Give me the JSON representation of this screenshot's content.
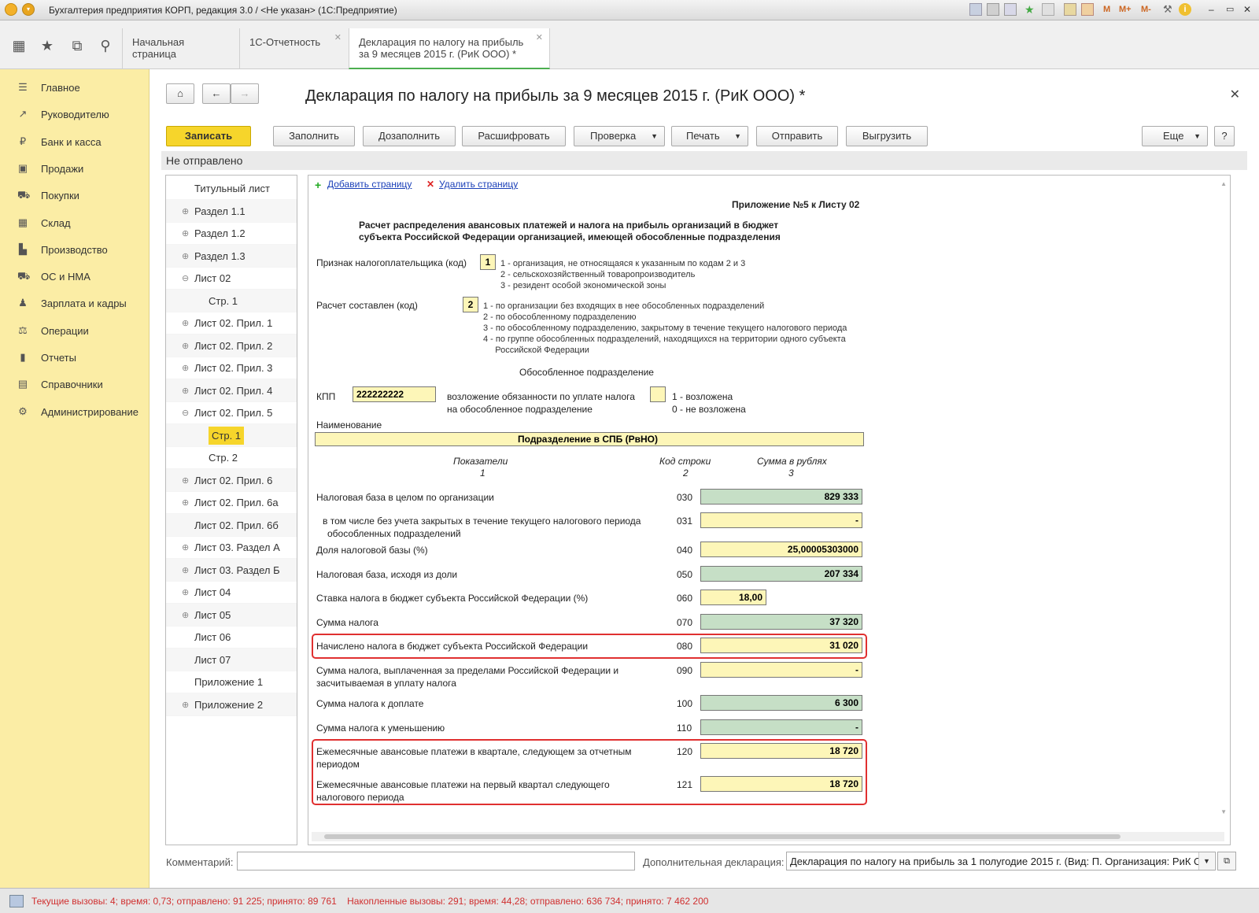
{
  "app": {
    "title": "Бухгалтерия предприятия КОРП, редакция 3.0 / <Не указан>  (1С:Предприятие)"
  },
  "titlebar_tools": {
    "m": "M",
    "mplus": "M+",
    "mminus": "M-"
  },
  "tabs": [
    {
      "label": "Начальная страница"
    },
    {
      "label": "1С-Отчетность"
    },
    {
      "label": "Декларация по налогу на прибыль\nза 9 месяцев 2015 г. (РиК ООО) *"
    }
  ],
  "sidebar": {
    "items": [
      {
        "label": "Главное",
        "icon": "menu-icon"
      },
      {
        "label": "Руководителю",
        "icon": "trend-icon"
      },
      {
        "label": "Банк и касса",
        "icon": "ruble-icon"
      },
      {
        "label": "Продажи",
        "icon": "bag-icon"
      },
      {
        "label": "Покупки",
        "icon": "cart-icon"
      },
      {
        "label": "Склад",
        "icon": "warehouse-icon"
      },
      {
        "label": "Производство",
        "icon": "factory-icon"
      },
      {
        "label": "ОС и НМА",
        "icon": "truck-icon"
      },
      {
        "label": "Зарплата и кадры",
        "icon": "person-icon"
      },
      {
        "label": "Операции",
        "icon": "scales-icon"
      },
      {
        "label": "Отчеты",
        "icon": "bar-chart-icon"
      },
      {
        "label": "Справочники",
        "icon": "book-icon"
      },
      {
        "label": "Администрирование",
        "icon": "gear-icon"
      }
    ]
  },
  "doc": {
    "title": "Декларация по налогу на прибыль за 9 месяцев 2015 г. (РиК ООО) *",
    "status": "Не отправлено",
    "toolbar": {
      "save": "Записать",
      "fill": "Заполнить",
      "refill": "Дозаполнить",
      "decode": "Расшифровать",
      "check": "Проверка",
      "print": "Печать",
      "send": "Отправить",
      "export": "Выгрузить",
      "more": "Еще",
      "help": "?"
    },
    "tree": [
      {
        "label": "Титульный лист",
        "expander": "",
        "level": 0
      },
      {
        "label": "Раздел 1.1",
        "expander": "⊕",
        "level": 0
      },
      {
        "label": "Раздел 1.2",
        "expander": "⊕",
        "level": 0
      },
      {
        "label": "Раздел 1.3",
        "expander": "⊕",
        "level": 0
      },
      {
        "label": "Лист 02",
        "expander": "⊖",
        "level": 0
      },
      {
        "label": "Стр. 1",
        "expander": "",
        "level": 1
      },
      {
        "label": "Лист 02. Прил. 1",
        "expander": "⊕",
        "level": 0
      },
      {
        "label": "Лист 02. Прил. 2",
        "expander": "⊕",
        "level": 0
      },
      {
        "label": "Лист 02. Прил. 3",
        "expander": "⊕",
        "level": 0
      },
      {
        "label": "Лист 02. Прил. 4",
        "expander": "⊕",
        "level": 0
      },
      {
        "label": "Лист 02. Прил. 5",
        "expander": "⊖",
        "level": 0
      },
      {
        "label": "Стр. 1",
        "expander": "",
        "level": 1,
        "selected": true
      },
      {
        "label": "Стр. 2",
        "expander": "",
        "level": 1
      },
      {
        "label": "Лист 02. Прил. 6",
        "expander": "⊕",
        "level": 0
      },
      {
        "label": "Лист 02. Прил. 6а",
        "expander": "⊕",
        "level": 0
      },
      {
        "label": "Лист 02. Прил. 6б",
        "expander": "",
        "level": 0
      },
      {
        "label": "Лист 03. Раздел А",
        "expander": "⊕",
        "level": 0
      },
      {
        "label": "Лист 03. Раздел Б",
        "expander": "⊕",
        "level": 0
      },
      {
        "label": "Лист 04",
        "expander": "⊕",
        "level": 0
      },
      {
        "label": "Лист 05",
        "expander": "⊕",
        "level": 0
      },
      {
        "label": "Лист 06",
        "expander": "",
        "level": 0
      },
      {
        "label": "Лист 07",
        "expander": "",
        "level": 0
      },
      {
        "label": "Приложение 1",
        "expander": "",
        "level": 0
      },
      {
        "label": "Приложение 2",
        "expander": "⊕",
        "level": 0
      }
    ],
    "form": {
      "add_page": "Добавить страницу",
      "del_page": "Удалить страницу",
      "appendix": "Приложение №5 к Листу 02",
      "heading1": "Расчет распределения авансовых платежей и налога на прибыль организаций в бюджет",
      "heading2": "субъекта Российской Федерации организацией, имеющей обособленные подразделения",
      "payer_label": "Признак налогоплательщика (код)",
      "payer_code": "1",
      "payer_opts": [
        "1 - организация, не относящаяся к указанным по кодам 2 и 3",
        "2 - сельскохозяйственный товаропроизводитель",
        "3 - резидент особой экономической зоны"
      ],
      "calc_label": "Расчет составлен (код)",
      "calc_code": "2",
      "calc_opts": [
        "1 - по организации без входящих в нее обособленных подразделений",
        "2 - по обособленному подразделению",
        "3 - по обособленному подразделению, закрытому в течение текущего налогового периода",
        "4 - по группе обособленных подразделений, находящихся на территории одного субъекта",
        "     Российской Федерации"
      ],
      "subdivision": "Обособленное подразделение",
      "kpp_label": "КПП",
      "kpp": "222222222",
      "duty_label1": "возложение обязанности по уплате налога",
      "duty_label2": "на обособленное подразделение",
      "duty_opt1": "1 - возложена",
      "duty_opt2": "0 - не возложена",
      "name_label": "Наименование",
      "name_value": "Подразделение в СПБ (РвНО)",
      "col1": "Показатели",
      "col1n": "1",
      "col2": "Код строки",
      "col2n": "2",
      "col3": "Сумма в рублях",
      "col3n": "3",
      "rows": [
        {
          "label": "Налоговая база в целом по организации",
          "label2": "",
          "code": "030",
          "value": "829 333",
          "color": "green",
          "narrow": false
        },
        {
          "label": "в том числе без учета закрытых в течение текущего налогового периода",
          "label2": "обособленных подразделений",
          "code": "031",
          "value": "-",
          "color": "yellow",
          "narrow": false,
          "indent": true
        },
        {
          "label": "Доля налоговой базы (%)",
          "label2": "",
          "code": "040",
          "value": "25,00005303000",
          "color": "yellow",
          "narrow": false
        },
        {
          "label": "Налоговая база, исходя из доли",
          "label2": "",
          "code": "050",
          "value": "207 334",
          "color": "green",
          "narrow": false
        },
        {
          "label": "Ставка налога в бюджет субъекта Российской Федерации (%)",
          "label2": "",
          "code": "060",
          "value": "18,00",
          "color": "yellow",
          "narrow": true
        },
        {
          "label": "Сумма налога",
          "label2": "",
          "code": "070",
          "value": "37 320",
          "color": "green",
          "narrow": false
        },
        {
          "label": "Начислено налога в бюджет субъекта Российской Федерации",
          "label2": "",
          "code": "080",
          "value": "31 020",
          "color": "yellow",
          "narrow": false
        },
        {
          "label": "Сумма налога, выплаченная за пределами Российской Федерации и",
          "label2": "засчитываемая в уплату налога",
          "code": "090",
          "value": "-",
          "color": "yellow",
          "narrow": false
        },
        {
          "label": "Сумма налога к доплате",
          "label2": "",
          "code": "100",
          "value": "6 300",
          "color": "green",
          "narrow": false
        },
        {
          "label": "Сумма налога к уменьшению",
          "label2": "",
          "code": "110",
          "value": "-",
          "color": "green",
          "narrow": false
        },
        {
          "label": "Ежемесячные авансовые платежи в квартале, следующем за отчетным",
          "label2": "периодом",
          "code": "120",
          "value": "18 720",
          "color": "yellow",
          "narrow": false
        },
        {
          "label": "Ежемесячные авансовые платежи на первый квартал следующего",
          "label2": "налогового периода",
          "code": "121",
          "value": "18 720",
          "color": "yellow",
          "narrow": false
        }
      ]
    },
    "comment_label": "Комментарий:",
    "comment_value": "",
    "extra_label": "Дополнительная декларация:",
    "extra_value": "Декларация по налогу на прибыль за 1 полугодие 2015 г. (Вид: П. Организация: РиК О"
  },
  "status_text": "Текущие вызовы: 4; время: 0,73; отправлено: 91 225; принято: 89 761    Накопленные вызовы: 291; время: 44,28; отправлено: 636 734; принято: 7 462 200",
  "colors": {
    "sidebar": "#fbeda5",
    "accent": "#f6d52b",
    "highlight": "#e03030",
    "yellow_field": "#fdf6b8",
    "green_field": "#c6dfc6"
  }
}
